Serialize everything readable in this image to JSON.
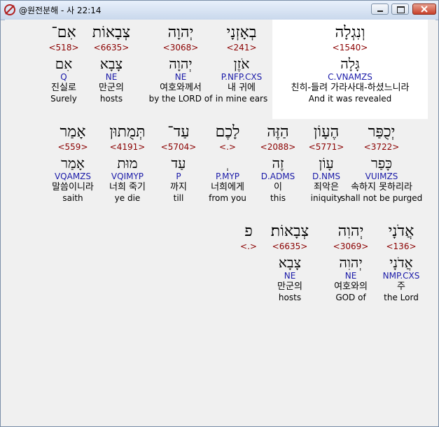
{
  "window": {
    "title": "@원전분해 - 사 22:14"
  },
  "rows": [
    {
      "words": [
        {
          "heb": "וְנִגְלָה",
          "strong": "<1540>",
          "lemma": "גָּלָה",
          "morph": "C.VNAMZS",
          "kor": "친히-들려 가라사대-하셨느니라",
          "eng": "And it was revealed",
          "highlight": true
        },
        {
          "heb": "בְאָזְנָי",
          "strong": "<241>",
          "lemma": "אֹזֶן",
          "morph": "P.NFP.CXS",
          "kor": "내 귀에",
          "eng": "in mine ears"
        },
        {
          "heb": "יְהוָה",
          "strong": "<3068>",
          "lemma": "יְהוָה",
          "morph": "NE",
          "kor": "여호와께서",
          "eng": "by the LORD of"
        },
        {
          "heb": "צְבָאוֹת",
          "strong": "<6635>",
          "lemma": "צָבָא",
          "morph": "NE",
          "kor": "만군의",
          "eng": "hosts"
        },
        {
          "heb": "אִם־",
          "strong": "<518>",
          "lemma": "אִם",
          "morph": "Q",
          "kor": "진실로",
          "eng": "Surely"
        }
      ]
    },
    {
      "words": [
        {
          "heb": "יְכֻפַּר",
          "strong": "<3722>",
          "lemma": "כָּפַר",
          "morph": "VUIMZS",
          "kor": "속하지 못하리라",
          "eng": "shall not be purged"
        },
        {
          "heb": "הֶעָוֹן",
          "strong": "<5771>",
          "lemma": "עָוֹן",
          "morph": "D.NMS",
          "kor": "죄악은",
          "eng": "iniquity"
        },
        {
          "heb": "הַזֶּה",
          "strong": "<2088>",
          "lemma": "זֶה",
          "morph": "D.ADMS",
          "kor": "이",
          "eng": "this"
        },
        {
          "heb": "לָכֶם",
          "strong": "<.>",
          "lemma": "ְ",
          "morph": "P.MYP",
          "kor": "너희에게",
          "eng": "from you"
        },
        {
          "heb": "עַד־",
          "strong": "<5704>",
          "lemma": "עַד",
          "morph": "P",
          "kor": "까지",
          "eng": "till"
        },
        {
          "heb": "תְּמֻתוּן",
          "strong": "<4191>",
          "lemma": "מוּת",
          "morph": "VQIMYP",
          "kor": "너희 죽기",
          "eng": "ye die"
        },
        {
          "heb": "אָמַר",
          "strong": "<559>",
          "lemma": "אָמַר",
          "morph": "VQAMZS",
          "kor": "말씀이니라",
          "eng": "saith"
        }
      ]
    },
    {
      "words": [
        {
          "heb": "אֲדֹנָי",
          "strong": "<136>",
          "lemma": "אֲדֹנָי",
          "morph": "NMP.CXS",
          "kor": "주",
          "eng": "the Lord"
        },
        {
          "heb": "יְהוִה",
          "strong": "<3069>",
          "lemma": "יְהוִה",
          "morph": "NE",
          "kor": "여호와의",
          "eng": "GOD of"
        },
        {
          "heb": "צְבָאוֹת׃",
          "strong": "<6635>",
          "lemma": "צָבָא",
          "morph": "NE",
          "kor": "만군의",
          "eng": "hosts"
        },
        {
          "heb": "פ",
          "strong": "<.>",
          "lemma": "",
          "morph": "",
          "kor": "",
          "eng": ""
        }
      ]
    }
  ]
}
